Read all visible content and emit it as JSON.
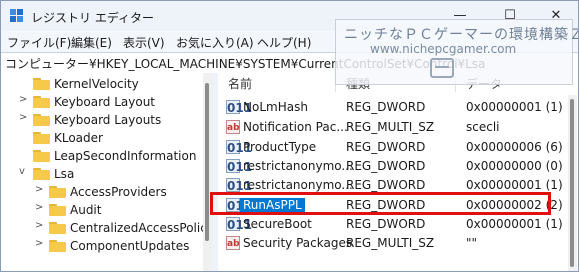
{
  "window": {
    "title": "レジストリ エディター",
    "min_glyph": "—",
    "max_glyph": "☐",
    "close_glyph": "✕"
  },
  "menu": [
    "ファイル(F)",
    "編集(E)",
    "表示(V)",
    "お気に入り(A)",
    "ヘルプ(H)"
  ],
  "address": "コンピューター¥HKEY_LOCAL_MACHINE¥SYSTEM¥CurrentControlSet¥Control¥Lsa",
  "tree": [
    {
      "label": "KernelVelocity",
      "chevron": ""
    },
    {
      "label": "Keyboard Layout",
      "chevron": ">"
    },
    {
      "label": "Keyboard Layouts",
      "chevron": ">"
    },
    {
      "label": "KLoader",
      "chevron": ""
    },
    {
      "label": "LeapSecondInformation",
      "chevron": ""
    },
    {
      "label": "Lsa",
      "chevron": "v"
    },
    {
      "label": "AccessProviders",
      "chevron": ">"
    },
    {
      "label": "Audit",
      "chevron": ">"
    },
    {
      "label": "CentralizedAccessPolicie",
      "chevron": ">"
    },
    {
      "label": "ComponentUpdates",
      "chevron": ">"
    }
  ],
  "columns": {
    "name": "名前",
    "type": "種類",
    "data": "データ"
  },
  "values": [
    {
      "icon": "binary-value-icon",
      "glyph": "011",
      "name": "NoLmHash",
      "type": "REG_DWORD",
      "data": "0x00000001 (1)"
    },
    {
      "icon": "string-value-icon",
      "glyph": "ab",
      "name": "Notification Pac...",
      "type": "REG_MULTI_SZ",
      "data": "scecli"
    },
    {
      "icon": "binary-value-icon",
      "glyph": "011",
      "name": "ProductType",
      "type": "REG_DWORD",
      "data": "0x00000006 (6)"
    },
    {
      "icon": "binary-value-icon",
      "glyph": "011",
      "name": "restrictanonymo...",
      "type": "REG_DWORD",
      "data": "0x00000000 (0)"
    },
    {
      "icon": "binary-value-icon",
      "glyph": "011",
      "name": "restrictanonymo...",
      "type": "REG_DWORD",
      "data": "0x00000001 (1)"
    },
    {
      "icon": "binary-value-icon",
      "glyph": "011",
      "name": "RunAsPPL",
      "type": "REG_DWORD",
      "data": "0x00000002 (2)"
    },
    {
      "icon": "binary-value-icon",
      "glyph": "011",
      "name": "SecureBoot",
      "type": "REG_DWORD",
      "data": "0x00000001 (1)"
    },
    {
      "icon": "string-value-icon",
      "glyph": "ab",
      "name": "Security Packages",
      "type": "REG_MULTI_SZ",
      "data": "\"\""
    }
  ],
  "watermark": {
    "title": "ニッチなＰＣゲーマーの環境構築Ｚ",
    "url": "www.nichepcgamer.com"
  },
  "colors": {
    "selection": "#0078d4",
    "highlight_box": "#e01010",
    "folder": "#f7c94a"
  }
}
